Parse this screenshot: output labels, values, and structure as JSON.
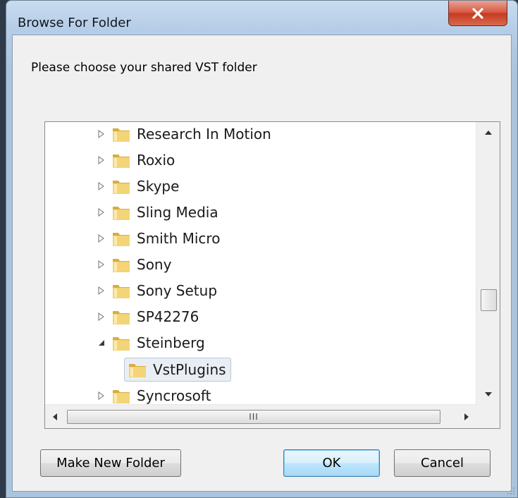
{
  "dialog": {
    "title": "Browse For Folder",
    "close_label": "X",
    "prompt": "Please choose your shared VST folder"
  },
  "tree": {
    "items": [
      {
        "label": "Research In Motion",
        "expanded": false
      },
      {
        "label": "Roxio",
        "expanded": false
      },
      {
        "label": "Skype",
        "expanded": false
      },
      {
        "label": "Sling Media",
        "expanded": false
      },
      {
        "label": "Smith Micro",
        "expanded": false
      },
      {
        "label": "Sony",
        "expanded": false
      },
      {
        "label": "Sony Setup",
        "expanded": false
      },
      {
        "label": "SP42276",
        "expanded": false
      },
      {
        "label": "Steinberg",
        "expanded": true
      },
      {
        "label": "VstPlugins",
        "selected": true
      },
      {
        "label": "Syncrosoft",
        "expanded": false
      }
    ],
    "hscroll_grip": "III"
  },
  "buttons": {
    "make_new_folder": "Make New Folder",
    "ok": "OK",
    "cancel": "Cancel"
  },
  "colors": {
    "folder": "#e8c45a",
    "default_button_border": "#3c7fb1",
    "close_button": "#d8573f"
  }
}
